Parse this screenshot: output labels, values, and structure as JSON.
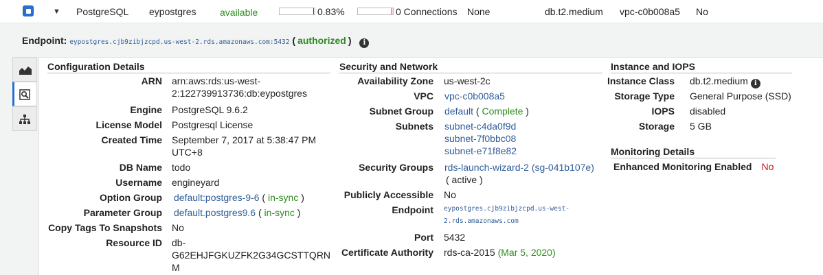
{
  "row": {
    "engine": "PostgreSQL",
    "name": "eypostgres",
    "status": "available",
    "cpu": "0.83%",
    "cpu_fraction": 0.83,
    "connections": "0 Connections",
    "replication": "None",
    "instance_class": "db.t2.medium",
    "vpc": "vpc-c0b008a5",
    "multi_az": "No"
  },
  "endpoint_bar": {
    "label": "Endpoint:",
    "value": "eypostgres.cjb9zibjzcpd.us-west-2.rds.amazonaws.com:5432",
    "open_paren": "(",
    "status": "authorized",
    "close_paren": ")"
  },
  "config": {
    "title": "Configuration Details",
    "arn_label": "ARN",
    "arn_line1": "arn:aws:rds:us-west-",
    "arn_line2": "2:122739913736:db:eypostgres",
    "engine_label": "Engine",
    "engine": "PostgreSQL 9.6.2",
    "license_label": "License Model",
    "license": "Postgresql License",
    "created_label": "Created Time",
    "created_line1": "September 7, 2017 at 5:38:47 PM",
    "created_line2": "UTC+8",
    "dbname_label": "DB Name",
    "dbname": "todo",
    "username_label": "Username",
    "username": "engineyard",
    "option_label": "Option Group",
    "option_group": "default:postgres-9-6",
    "option_status": "in-sync",
    "param_label": "Parameter Group",
    "param_group": "default.postgres9.6",
    "param_status": "in-sync",
    "copytags_label": "Copy Tags To Snapshots",
    "copytags": "No",
    "resource_label": "Resource ID",
    "resource_line1": "db-",
    "resource_line2": "G62EHJFGKUZFK2G34GCSTTQRN",
    "resource_line3": "M"
  },
  "security": {
    "title": "Security and Network",
    "az_label": "Availability Zone",
    "az": "us-west-2c",
    "vpc_label": "VPC",
    "vpc": "vpc-c0b008a5",
    "subnet_group_label": "Subnet Group",
    "subnet_group": "default",
    "subnet_group_status": "Complete",
    "subnets_label": "Subnets",
    "subnets": [
      "subnet-c4da0f9d",
      "subnet-7f0bbc08",
      "subnet-e71f8e82"
    ],
    "sg_label": "Security Groups",
    "sg": "rds-launch-wizard-2 (sg-041b107e)",
    "sg_status": "( active )",
    "public_label": "Publicly Accessible",
    "public": "No",
    "endpoint_label": "Endpoint",
    "endpoint_line1": "eypostgres.cjb9zibjzcpd.us-west-",
    "endpoint_line2": "2.rds.amazonaws.com",
    "port_label": "Port",
    "port": "5432",
    "ca_label": "Certificate Authority",
    "ca": "rds-ca-2015",
    "ca_date": "(Mar 5, 2020)"
  },
  "instance": {
    "title": "Instance and IOPS",
    "class_label": "Instance Class",
    "class": "db.t2.medium",
    "storage_type_label": "Storage Type",
    "storage_type": "General Purpose (SSD)",
    "iops_label": "IOPS",
    "iops": "disabled",
    "storage_label": "Storage",
    "storage": "5 GB"
  },
  "monitoring": {
    "title": "Monitoring Details",
    "enhanced_label": "Enhanced Monitoring Enabled",
    "enhanced": "No"
  },
  "colors": {
    "accent": "#2a6fd0",
    "link": "#2f5d9a",
    "success": "#2e8b1f",
    "danger": "#c0141a"
  },
  "icons": [
    "chart-icon",
    "magnifier-icon",
    "hierarchy-icon",
    "info-icon",
    "expand-triangle-icon"
  ]
}
